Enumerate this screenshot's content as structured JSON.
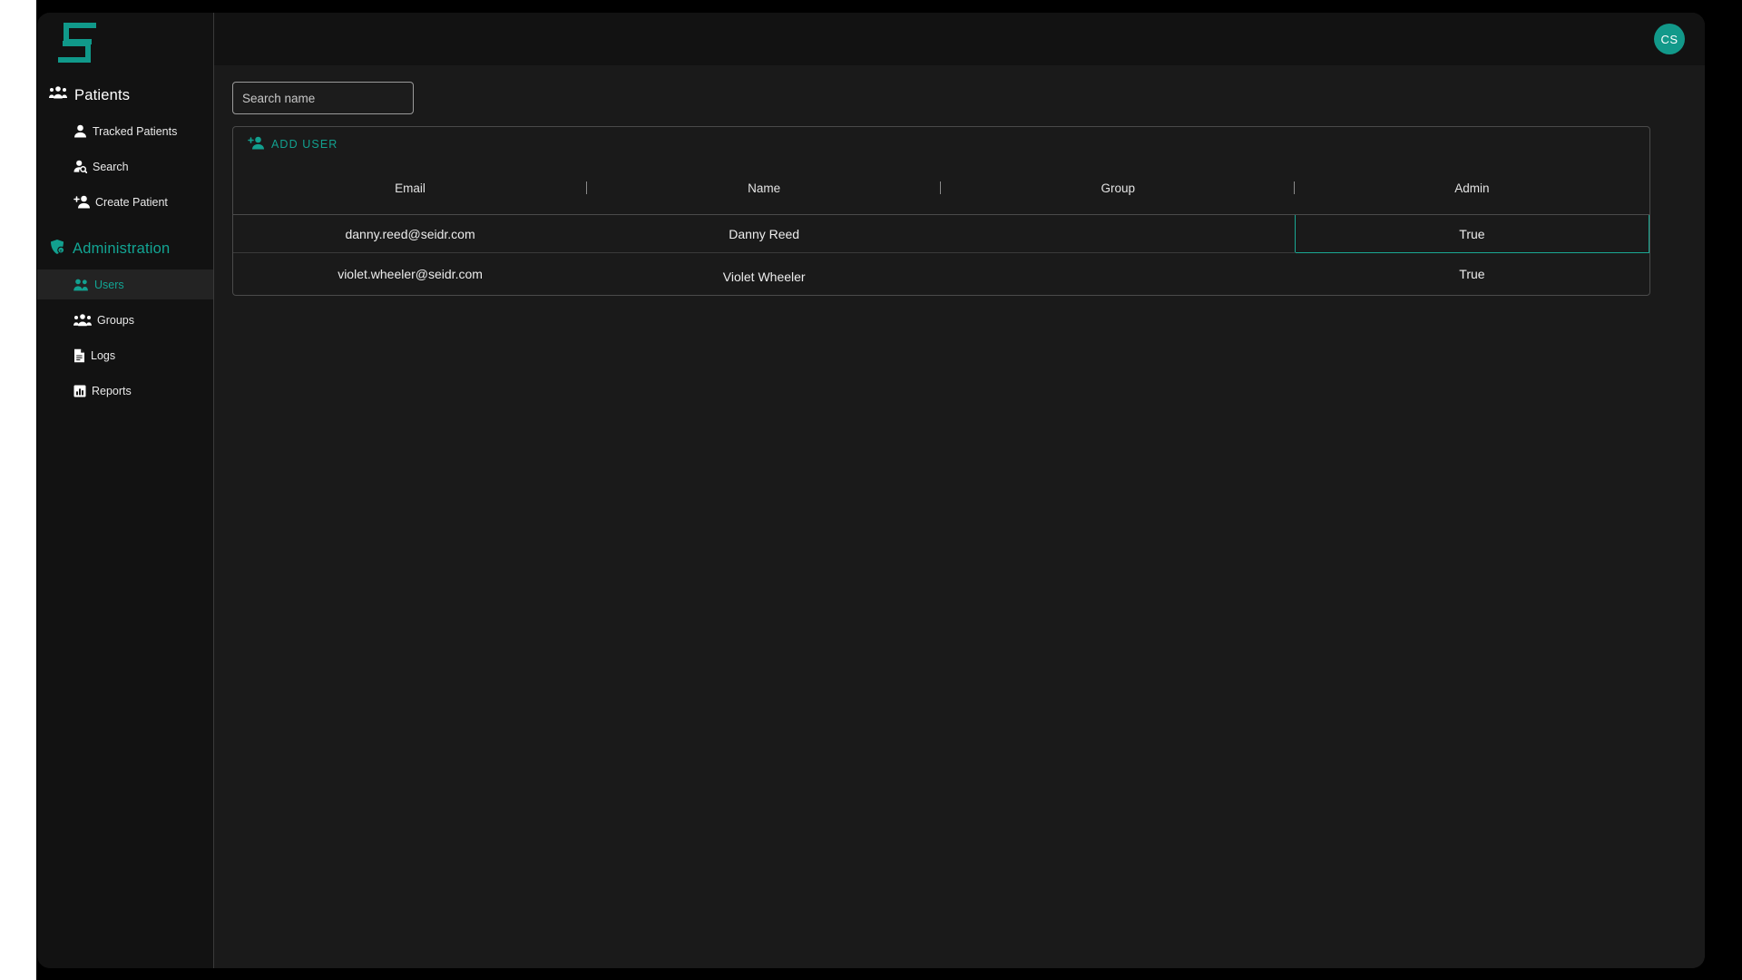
{
  "app": {
    "logo_icon": "seidr-logo-icon",
    "avatar_initials": "CS"
  },
  "sidebar": {
    "groups": [
      {
        "label": "Patients",
        "icon": "people-group-icon",
        "accent": "#ffffff",
        "items": [
          {
            "label": "Tracked Patients",
            "icon": "person-icon",
            "active": false
          },
          {
            "label": "Search",
            "icon": "person-search-icon",
            "active": false
          },
          {
            "label": "Create Patient",
            "icon": "person-add-icon",
            "active": false
          }
        ]
      },
      {
        "label": "Administration",
        "icon": "shield-admin-icon",
        "accent": "#12a594",
        "items": [
          {
            "label": "Users",
            "icon": "users-icon",
            "active": true
          },
          {
            "label": "Groups",
            "icon": "groups-icon",
            "active": false
          },
          {
            "label": "Logs",
            "icon": "document-icon",
            "active": false
          },
          {
            "label": "Reports",
            "icon": "bar-chart-icon",
            "active": false
          }
        ]
      }
    ]
  },
  "search": {
    "placeholder": "Search name",
    "value": ""
  },
  "toolbar": {
    "add_user_label": "ADD USER",
    "add_user_icon": "person-add-icon"
  },
  "table": {
    "columns": [
      "Email",
      "Name",
      "Group",
      "Admin"
    ],
    "rows": [
      {
        "email": "danny.reed@seidr.com",
        "name": "Danny Reed",
        "group": "",
        "admin": "True",
        "admin_selected": true
      },
      {
        "email": "violet.wheeler@seidr.com",
        "name": "Violet Wheeler",
        "group": "",
        "admin": "True",
        "admin_selected": false
      }
    ]
  },
  "colors": {
    "accent": "#12a594",
    "accent_selected_border": "#1aa893",
    "window_bg": "#121212",
    "content_bg": "#1a1a1a",
    "panel_border": "#4a4a4a",
    "active_nav_bg": "#232323"
  }
}
